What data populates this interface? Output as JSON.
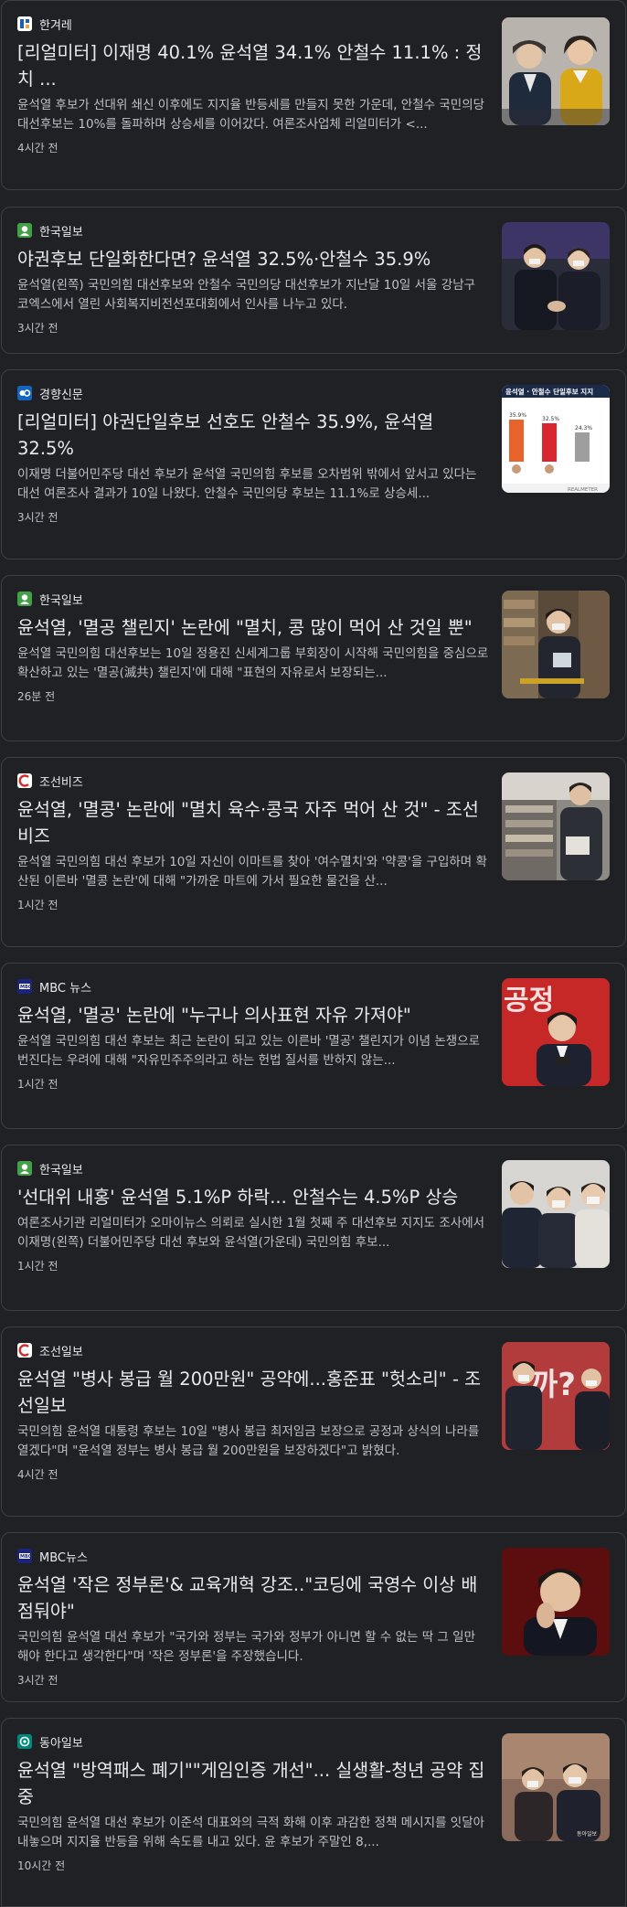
{
  "articles": [
    {
      "source": "한겨레",
      "source_icon": "hankyoreh-logo-icon",
      "headline": "[리얼미터] 이재명 40.1% 윤석열 34.1% 안철수 11.1% : 정치 ...",
      "snippet": "윤석열 후보가 선대위 쇄신 이후에도 지지율 반등세를 만들지 못한 가운데, 안철수 국민의당 대선후보는 10%를 돌파하며 상승세를 이어갔다. 여론조사업체 리얼미터가 <...",
      "time": "4시간 전"
    },
    {
      "source": "한국일보",
      "source_icon": "hankookilbo-logo-icon",
      "headline": "야권후보 단일화한다면? 윤석열 32.5%·안철수 35.9%",
      "snippet": "윤석열(왼쪽) 국민의힘 대선후보와 안철수 국민의당 대선후보가 지난달 10일 서울 강남구 코엑스에서 열린 사회복지비전선포대회에서 인사를 나누고 있다.",
      "time": "3시간 전"
    },
    {
      "source": "경향신문",
      "source_icon": "kyunghyang-logo-icon",
      "headline": "[리얼미터] 야권단일후보 선호도 안철수 35.9%, 윤석열 32.5%",
      "snippet": "이재명 더불어민주당 대선 후보가 윤석열 국민의힘 후보를 오차범위 밖에서 앞서고 있다는 대선 여론조사 결과가 10일 나왔다. 안철수 국민의당 후보는 11.1%로 상승세...",
      "time": "3시간 전",
      "thumb_title": "윤석열 · 안철수 단일후보 지지",
      "thumb_footer": "REALMETER"
    },
    {
      "source": "한국일보",
      "source_icon": "hankookilbo-logo-icon",
      "headline": "윤석열, '멸공 챌린지' 논란에 \"멸치, 콩 많이 먹어 산 것일 뿐\"",
      "snippet": "윤석열 국민의힘 대선후보는 10일 정용진 신세계그룹 부회장이 시작해 국민의힘을 중심으로 확산하고 있는 '멸공(滅共) 챌린지'에 대해 \"표현의 자유로서 보장되는...",
      "time": "26분 전"
    },
    {
      "source": "조선비즈",
      "source_icon": "chosunbiz-logo-icon",
      "headline": "윤석열, '멸콩' 논란에 \"멸치 육수·콩국 자주 먹어 산 것\" - 조선비즈",
      "snippet": "윤석열 국민의힘 대선 후보가 10일 자신이 이마트를 찾아 '여수멸치'와 '약콩'을 구입하며 확산된 이른바 '멸콩 논란'에 대해 \"가까운 마트에 가서 필요한 물건을 산...",
      "time": "1시간 전"
    },
    {
      "source": "MBC 뉴스",
      "source_icon": "mbc-logo-icon",
      "headline": "윤석열, '멸공' 논란에 \"누구나 의사표현 자유 가져야\"",
      "snippet": "윤석열 국민의힘 대선 후보는 최근 논란이 되고 있는 이른바 '멸공' 챌린지가 이념 논쟁으로 번진다는 우려에 대해 \"자유민주주의라고 하는 헌법 질서를 반하지 않는...",
      "time": "1시간 전",
      "thumb_text": "공정"
    },
    {
      "source": "한국일보",
      "source_icon": "hankookilbo-logo-icon",
      "headline": "'선대위 내홍' 윤석열 5.1%P 하락... 안철수는 4.5%P 상승",
      "snippet": "여론조사기관 리얼미터가 오마이뉴스 의뢰로 실시한 1월 첫째 주 대선후보 지지도 조사에서 이재명(왼쪽) 더불어민주당 대선 후보와 윤석열(가운데) 국민의힘 후보...",
      "time": "1시간 전"
    },
    {
      "source": "조선일보",
      "source_icon": "chosun-logo-icon",
      "headline": "윤석열 \"병사 봉급 월 200만원\" 공약에...홍준표 \"헛소리\" - 조선일보",
      "snippet": "국민의힘 윤석열 대통령 후보는 10일 \"병사 봉급 최저임금 보장으로 공정과 상식의 나라를 열겠다\"며 \"윤석열 정부는 병사 봉급 월 200만원을 보장하겠다\"고 밝혔다.",
      "time": "4시간 전",
      "thumb_text": "까?"
    },
    {
      "source": "MBC뉴스",
      "source_icon": "mbc-logo-icon",
      "headline": "윤석열 '작은 정부론'& 교육개혁 강조..\"코딩에 국영수 이상 배점둬야\"",
      "snippet": "국민의힘 윤석열 대선 후보가 \"국가와 정부는 국가와 정부가 아니면 할 수 없는 딱 그 일만 해야 한다고 생각한다\"며 '작은 정부론'을 주장했습니다.",
      "time": "3시간 전"
    },
    {
      "source": "동아일보",
      "source_icon": "donga-logo-icon",
      "headline": "윤석열 \"방역패스 폐기\"\"게임인증 개선\"... 실생활-청년 공약 집중",
      "snippet": "국민의힘 윤석열 대선 후보가 이준석 대표와의 극적 화해 이후 과감한 정책 메시지를 잇달아 내놓으며 지지율 반등을 위해 속도를 내고 있다. 윤 후보가 주말인 8,...",
      "time": "10시간 전",
      "thumb_text": "동아일보"
    }
  ]
}
